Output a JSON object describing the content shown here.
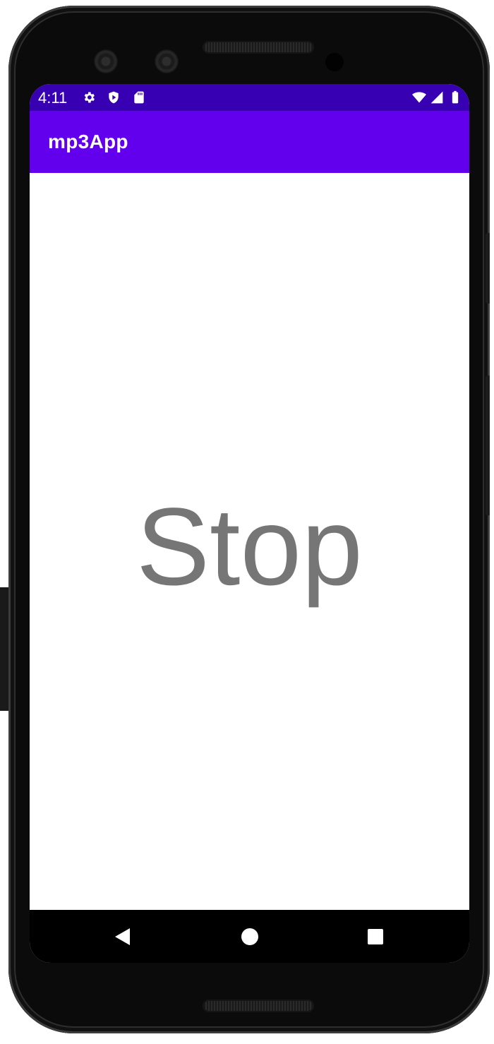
{
  "status_bar": {
    "time": "4:11",
    "left_icons": [
      "gear-icon",
      "shield-play-icon",
      "sd-card-icon"
    ],
    "right_icons": [
      "wifi-icon",
      "signal-icon",
      "battery-icon"
    ],
    "color": "#3700b3"
  },
  "app_bar": {
    "title": "mp3App",
    "color": "#6200ee"
  },
  "main": {
    "stop_label": "Stop",
    "text_color": "#767676"
  },
  "nav_bar": {
    "buttons": [
      "back-icon",
      "home-icon",
      "recents-icon"
    ]
  }
}
